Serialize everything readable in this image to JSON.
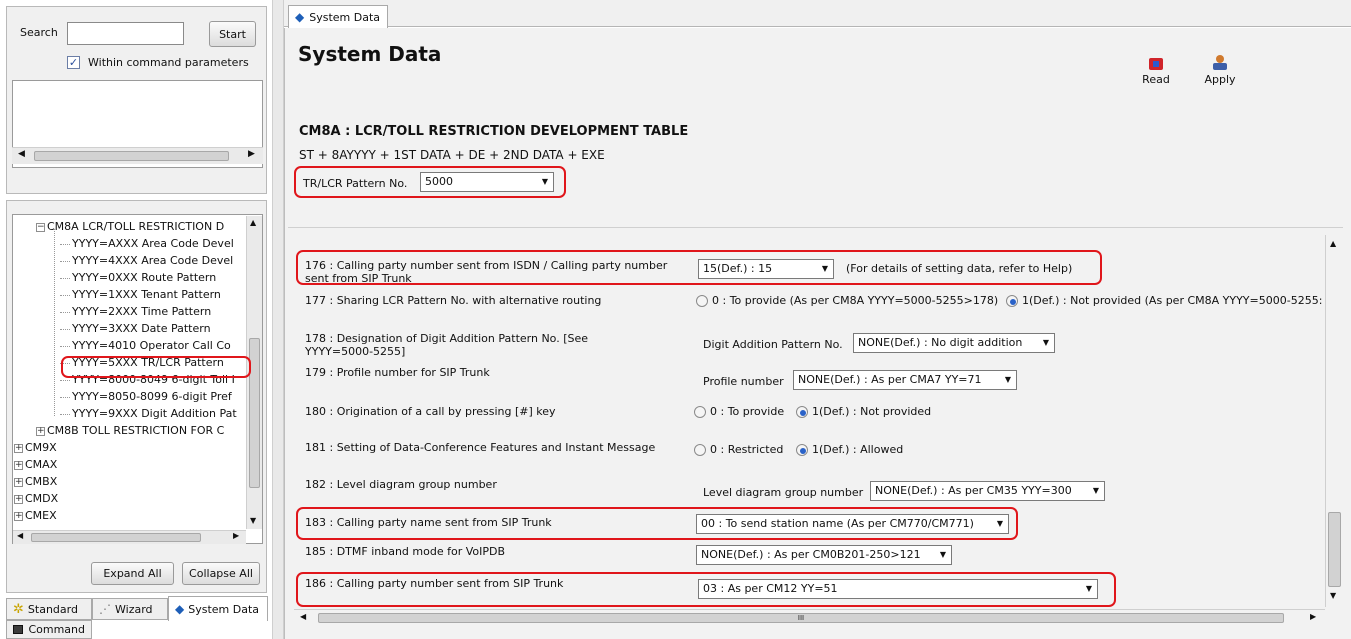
{
  "left": {
    "search_label": "Search",
    "search_value": "",
    "start_label": "Start",
    "within_label": "Within command parameters",
    "within_checked": true,
    "tree": [
      {
        "label": "CM8A LCR/TOLL RESTRICTION D",
        "level": 0,
        "expander": "−"
      },
      {
        "label": "YYYY=AXXX Area Code Devel",
        "level": 1
      },
      {
        "label": "YYYY=4XXX Area Code Devel",
        "level": 1
      },
      {
        "label": "YYYY=0XXX Route Pattern",
        "level": 1
      },
      {
        "label": "YYYY=1XXX Tenant Pattern",
        "level": 1
      },
      {
        "label": "YYYY=2XXX Time Pattern",
        "level": 1
      },
      {
        "label": "YYYY=3XXX Date Pattern",
        "level": 1
      },
      {
        "label": "YYYY=4010 Operator Call Co",
        "level": 1
      },
      {
        "label": "YYYY=5XXX TR/LCR Pattern",
        "level": 1
      },
      {
        "label": "YYYY=8000-8049 6-digit Toll I",
        "level": 1
      },
      {
        "label": "YYYY=8050-8099 6-digit Pref",
        "level": 1
      },
      {
        "label": "YYYY=9XXX Digit Addition Pat",
        "level": 1
      },
      {
        "label": "CM8B TOLL RESTRICTION FOR C",
        "level": 0,
        "expander": "+"
      },
      {
        "label": "CM9X",
        "level": -1,
        "expander": "+"
      },
      {
        "label": "CMAX",
        "level": -1,
        "expander": "+"
      },
      {
        "label": "CMBX",
        "level": -1,
        "expander": "+"
      },
      {
        "label": "CMDX",
        "level": -1,
        "expander": "+"
      },
      {
        "label": "CMEX",
        "level": -1,
        "expander": "+"
      }
    ],
    "expand_all": "Expand All",
    "collapse_all": "Collapse All",
    "tabs": [
      "Standard",
      "Wizard",
      "System Data"
    ],
    "command_tab": "Command"
  },
  "main": {
    "tab_label": "System Data",
    "title": "System Data",
    "read_label": "Read",
    "apply_label": "Apply",
    "cm_title": "CM8A : LCR/TOLL RESTRICTION DEVELOPMENT TABLE",
    "cm_format": "ST + 8AYYYY + 1ST DATA + DE + 2ND DATA + EXE",
    "pattern_label": "TR/LCR Pattern No.",
    "pattern_value": "5000",
    "rows": {
      "r176": {
        "label": "176 : Calling party number sent from ISDN / Calling party number sent from SIP Trunk",
        "value": "15(Def.) :  15",
        "note": "(For details of setting data, refer to Help)"
      },
      "r177": {
        "label": "177 : Sharing LCR Pattern No. with alternative routing",
        "opt1": "0 : To provide (As per CM8A YYYY=5000-5255>178)",
        "opt2": "1(Def.) : Not provided (As per CM8A YYYY=5000-5255:"
      },
      "r178": {
        "label": "178 : Designation of Digit Addition Pattern No. [See YYYY=5000-5255]",
        "sublabel": "Digit Addition Pattern No.",
        "value": "NONE(Def.) : No digit addition"
      },
      "r179": {
        "label": "179 : Profile number for SIP Trunk",
        "sublabel": "Profile number",
        "value": "NONE(Def.) : As per CMA7 YY=71"
      },
      "r180": {
        "label": "180 : Origination of a call by pressing [#]  key",
        "opt1": "0 : To provide",
        "opt2": "1(Def.) : Not provided"
      },
      "r181": {
        "label": "181 : Setting of Data-Conference Features and Instant Message",
        "opt1": "0 : Restricted",
        "opt2": "1(Def.) : Allowed"
      },
      "r182": {
        "label": "182 : Level diagram group number",
        "sublabel": "Level diagram group number",
        "value": "NONE(Def.) : As per CM35 YYY=300"
      },
      "r183": {
        "label": "183 : Calling party name sent from SIP Trunk",
        "value": "00 : To send station name (As per CM770/CM771)"
      },
      "r185": {
        "label": "185 : DTMF inband mode for VoIPDB",
        "value": "NONE(Def.) : As per CM0B201-250>121"
      },
      "r186": {
        "label": "186 : Calling party number sent from SIP Trunk",
        "value": "03 : As per CM12 YY=51"
      }
    },
    "scroll_h_mark": "III"
  },
  "colors": {
    "highlight": "#e0161b",
    "radio_selected": "#2a62c8"
  }
}
